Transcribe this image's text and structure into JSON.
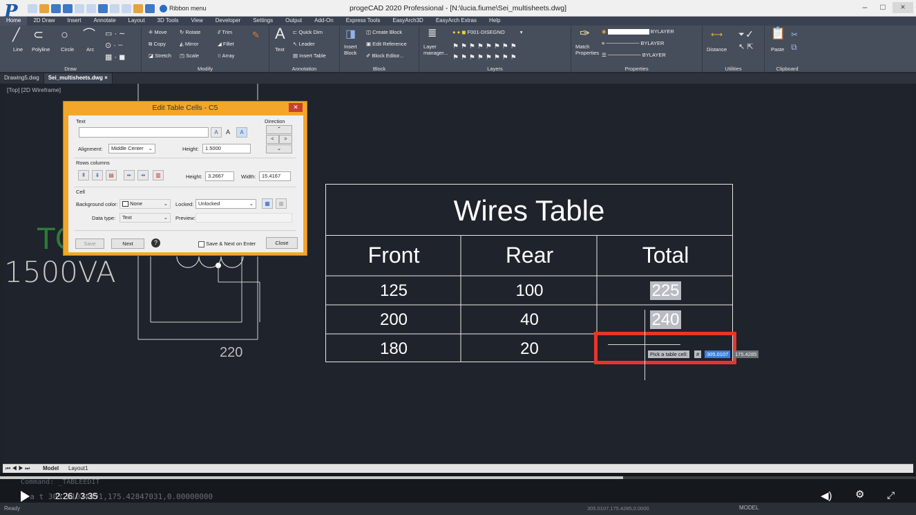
{
  "app": {
    "title": "progeCAD 2020 Professional - [N:\\lucia.fiume\\Sei_multisheets.dwg]",
    "logo": "P",
    "ribbon_menu_label": "Ribbon menu",
    "window_controls": [
      "–",
      "□",
      "×"
    ]
  },
  "tabs": [
    "Home",
    "2D Draw",
    "Insert",
    "Annotate",
    "Layout",
    "3D Tools",
    "View",
    "Developer",
    "Settings",
    "Output",
    "Add-On",
    "Express Tools",
    "EasyArch3D",
    "EasyArch Extras",
    "Help"
  ],
  "ribbon": {
    "draw": {
      "label": "Draw",
      "line": "Line",
      "polyline": "Polyline",
      "circle": "Circle",
      "arc": "Arc"
    },
    "modify": {
      "label": "Modify",
      "move": "Move",
      "copy": "Copy",
      "stretch": "Stretch",
      "rotate": "Rotate",
      "mirror": "Mirror",
      "scale": "Scale",
      "trim": "Trim",
      "fillet": "Fillet",
      "array": "Array"
    },
    "annotation": {
      "label": "Annotation",
      "text": "Text",
      "quick_dim": "Quick Dim",
      "leader": "Leader",
      "insert_table": "Insert Table"
    },
    "block": {
      "label": "Block",
      "insert_block": "Insert Block",
      "create_block": "Create Block",
      "edit_reference": "Edit Reference",
      "block_editor": "Block Editor..."
    },
    "layers": {
      "label": "Layers",
      "layer_manager": "Layer manager...",
      "current_layer": "F001-DISEGNO"
    },
    "properties": {
      "label": "Properties",
      "match": "Match Properties",
      "color": "BYLAYER",
      "linetype": "BYLAYER",
      "lineweight": "BYLAYER"
    },
    "utilities": {
      "label": "Utilities",
      "distance": "Distance"
    },
    "clipboard": {
      "label": "Clipboard",
      "paste": "Paste"
    }
  },
  "doc_tabs": [
    "Drawing5.dwg",
    "Sei_multisheets.dwg"
  ],
  "view_label": "[Top] [2D Wireframe]",
  "canvas_texts": {
    "big_to": "TO",
    "big_va": "1500VA",
    "num_220": "220"
  },
  "dialog": {
    "title": "Edit Table Cells - C5",
    "text_section": "Text",
    "direction_label": "Direction",
    "alignment_label": "Alignment:",
    "alignment_value": "Middle Center",
    "text_height_label": "Height:",
    "text_height_value": "1.5000",
    "rows_columns_label": "Rows columns",
    "row_height_label": "Height:",
    "row_height_value": "3.2667",
    "width_label": "Width:",
    "width_value": "15.4167",
    "cell_section": "Cell",
    "bg_color_label": "Background color:",
    "bg_color_value": "None",
    "locked_label": "Locked:",
    "locked_value": "Unlocked",
    "data_type_label": "Data type:",
    "data_type_value": "Text",
    "preview_label": "Preview:",
    "save_btn": "Save",
    "next_btn": "Next",
    "save_next_label": "Save & Next on Enter",
    "close_btn": "Close"
  },
  "wires_table": {
    "title": "Wires Table",
    "headers": [
      "Front",
      "Rear",
      "Total"
    ],
    "rows": [
      [
        "125",
        "100",
        "225"
      ],
      [
        "200",
        "40",
        "240"
      ],
      [
        "180",
        "20",
        ""
      ]
    ]
  },
  "tooltip": {
    "prompt": "Pick a table cell:",
    "x": "305.0107",
    "y": "175.4285"
  },
  "layout_tabs": [
    "Model",
    "Layout1"
  ],
  "command_line": "P    a  t   305.01074891,175.42847031,0.00000000",
  "command_line_top": "Command: _TABLEEDIT",
  "player": {
    "time": "2:26 / 3:35",
    "progress": 0.68
  },
  "status": {
    "ready": "Ready",
    "coords": "305.0107,175.4285,0.0000",
    "model": "MODEL"
  },
  "colors": {
    "accent_highlight": "#e8352a",
    "dialog_frame": "#f4a62a",
    "canvas": "#1f232b",
    "green_text": "#2f7a3a"
  }
}
